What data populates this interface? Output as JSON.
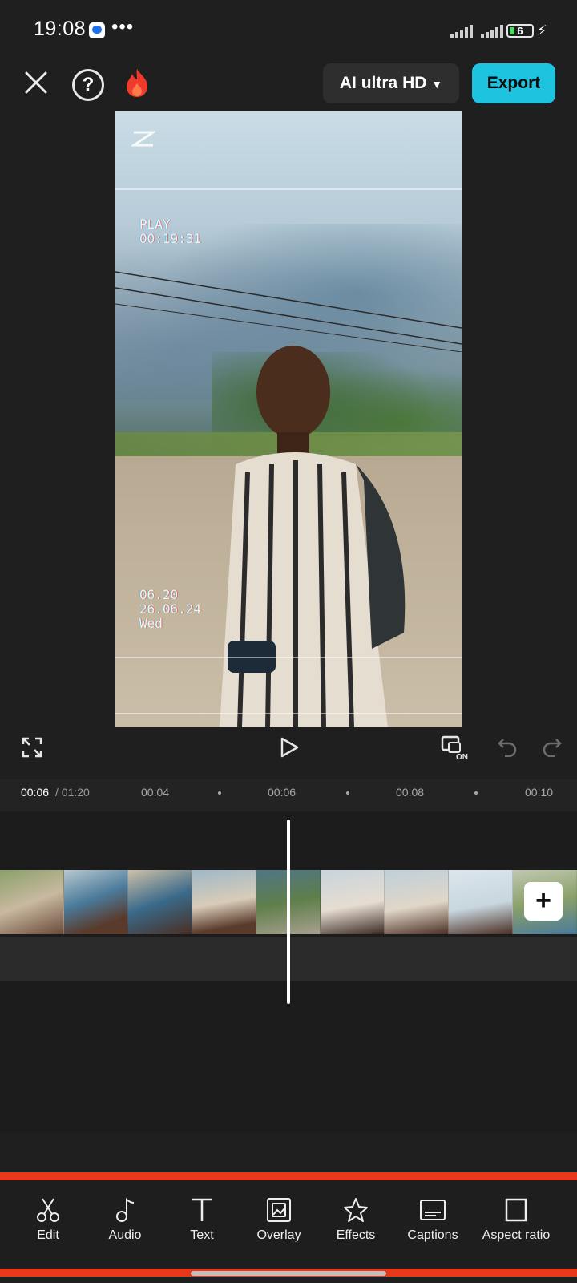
{
  "status_bar": {
    "time": "19:08",
    "battery_level": "6",
    "more_icon": "•••"
  },
  "top_toolbar": {
    "quality_label": "AI ultra HD",
    "export_label": "Export",
    "help_label": "?"
  },
  "preview": {
    "vhs_top_line1": "PLAY",
    "vhs_top_line2": "00:19:31",
    "vhs_bottom_line1": "06.20",
    "vhs_bottom_line2": "26.06.24",
    "vhs_bottom_line3": "Wed"
  },
  "timeline": {
    "current_time": "00:06",
    "total_time": "/ 01:20",
    "ticks": [
      "00:04",
      "00:06",
      "00:08",
      "00:10"
    ],
    "add_label": "+"
  },
  "toolbar": {
    "items": [
      {
        "label": "Edit",
        "icon": "scissors-icon"
      },
      {
        "label": "Audio",
        "icon": "music-note-icon"
      },
      {
        "label": "Text",
        "icon": "text-icon"
      },
      {
        "label": "Overlay",
        "icon": "overlay-icon"
      },
      {
        "label": "Effects",
        "icon": "star-effects-icon"
      },
      {
        "label": "Captions",
        "icon": "captions-icon"
      },
      {
        "label": "Aspect ratio",
        "icon": "aspect-ratio-icon"
      }
    ]
  },
  "colors": {
    "accent": "#1ec3e0",
    "toolbar_border": "#e8381a",
    "background": "#1f1f1f"
  }
}
